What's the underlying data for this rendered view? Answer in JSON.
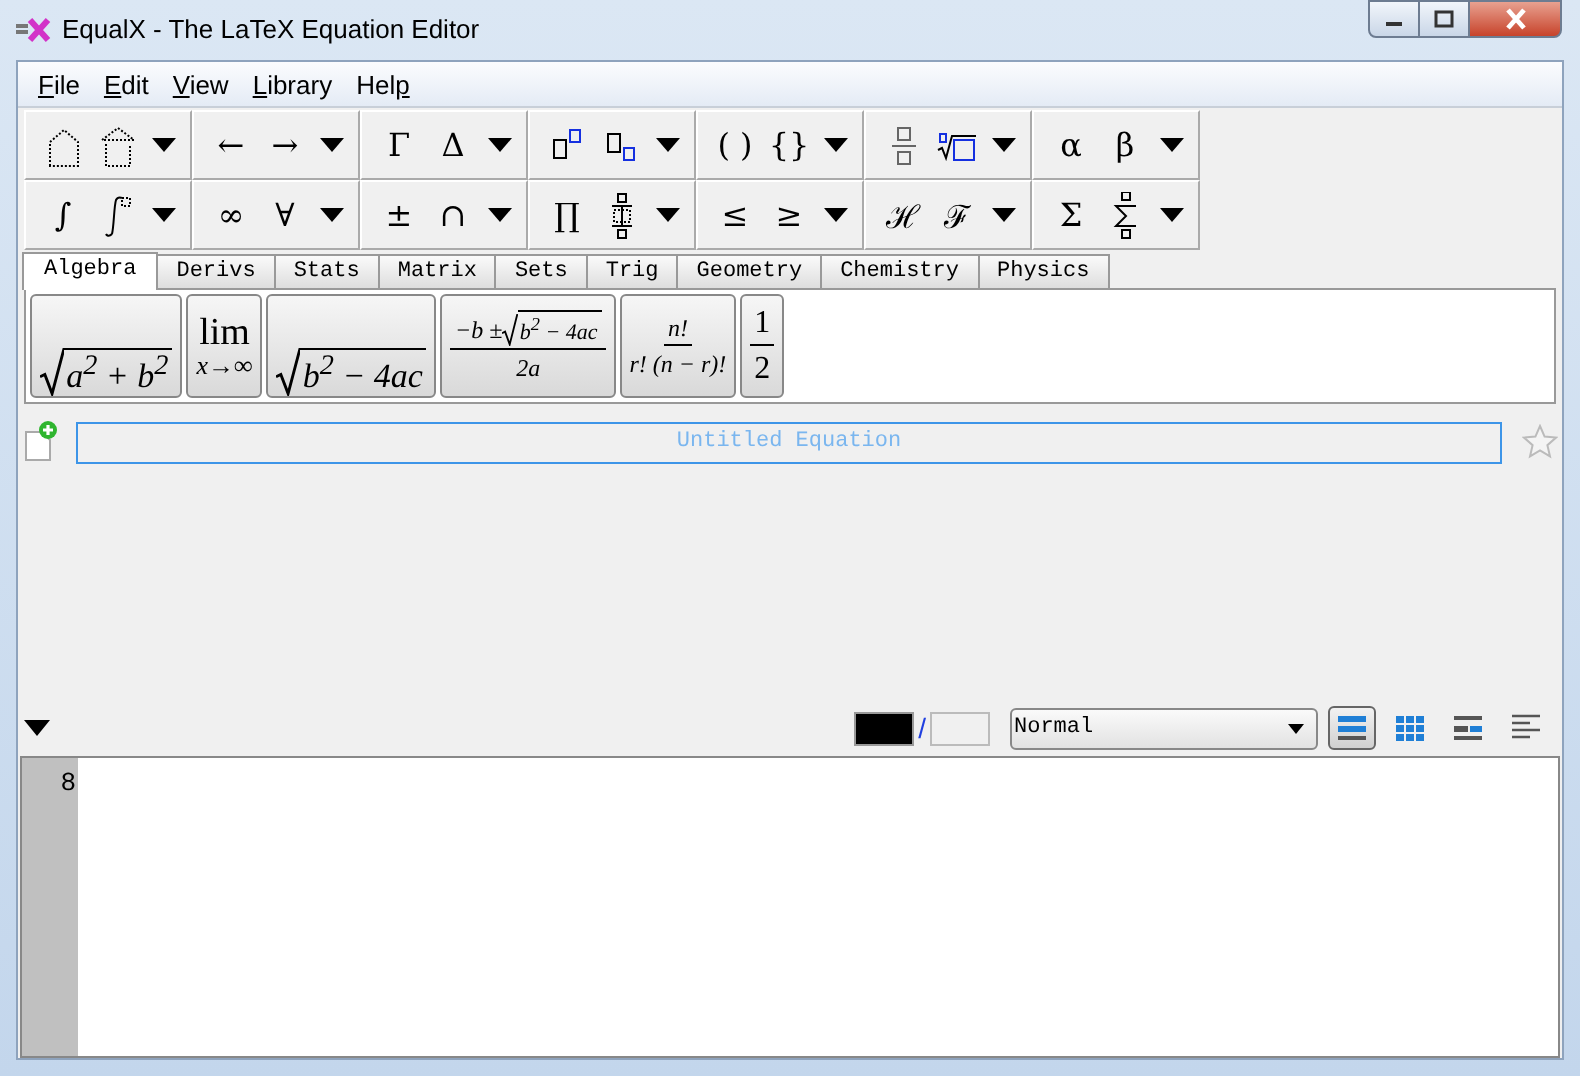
{
  "window": {
    "title": "EqualX - The LaTeX Equation Editor"
  },
  "menu": [
    {
      "key": "F",
      "after": "ile"
    },
    {
      "key": "E",
      "after": "dit"
    },
    {
      "key": "V",
      "after": "iew"
    },
    {
      "key": "L",
      "after": "ibrary"
    },
    {
      "before": "Hel",
      "key": "p"
    }
  ],
  "toolbar": {
    "rows": [
      [
        {
          "buttons": [
            {
              "kind": "hat"
            },
            {
              "kind": "hatbox"
            }
          ]
        },
        {
          "buttons": [
            {
              "kind": "symbol",
              "symbol": "←"
            },
            {
              "kind": "symbol",
              "symbol": "→"
            }
          ]
        },
        {
          "buttons": [
            {
              "kind": "symbol",
              "symbol": "Γ"
            },
            {
              "kind": "symbol",
              "symbol": "Δ"
            }
          ]
        },
        {
          "buttons": [
            {
              "kind": "supbox"
            },
            {
              "kind": "subbox"
            }
          ]
        },
        {
          "buttons": [
            {
              "kind": "symbol",
              "symbol": "( )"
            },
            {
              "kind": "symbol",
              "symbol": "{}"
            }
          ]
        },
        {
          "buttons": [
            {
              "kind": "fraction"
            },
            {
              "kind": "root"
            }
          ]
        },
        {
          "buttons": [
            {
              "kind": "symbol",
              "symbol": "α"
            },
            {
              "kind": "symbol",
              "symbol": "β"
            }
          ]
        }
      ],
      [
        {
          "buttons": [
            {
              "kind": "symbol",
              "symbol": "∫"
            },
            {
              "kind": "intlimits"
            }
          ]
        },
        {
          "buttons": [
            {
              "kind": "symbol",
              "symbol": "∞"
            },
            {
              "kind": "symbol",
              "symbol": "∀"
            }
          ]
        },
        {
          "buttons": [
            {
              "kind": "symbol",
              "symbol": "±"
            },
            {
              "kind": "symbol",
              "symbol": "∩"
            }
          ]
        },
        {
          "buttons": [
            {
              "kind": "symbol",
              "symbol": "∏"
            },
            {
              "kind": "stack"
            }
          ]
        },
        {
          "buttons": [
            {
              "kind": "symbol",
              "symbol": "≤"
            },
            {
              "kind": "symbol",
              "symbol": "≥"
            }
          ]
        },
        {
          "buttons": [
            {
              "kind": "symbol",
              "symbol": "ℋ"
            },
            {
              "kind": "symbol",
              "symbol": "ℱ"
            }
          ]
        },
        {
          "buttons": [
            {
              "kind": "symbol",
              "symbol": "Σ"
            },
            {
              "kind": "sumlimits"
            }
          ]
        }
      ]
    ]
  },
  "tabs": [
    {
      "label": "Algebra",
      "selected": true
    },
    {
      "label": "Derivs",
      "selected": false
    },
    {
      "label": "Stats",
      "selected": false
    },
    {
      "label": "Matrix",
      "selected": false
    },
    {
      "label": "Sets",
      "selected": false
    },
    {
      "label": "Trig",
      "selected": false
    },
    {
      "label": "Geometry",
      "selected": false
    },
    {
      "label": "Chemistry",
      "selected": false
    },
    {
      "label": "Physics",
      "selected": false
    }
  ],
  "formulas": [
    {
      "kind": "sqrt",
      "radicand": "a$^{2}$ + b$^{2}$"
    },
    {
      "kind": "limit",
      "top": "lim",
      "bottom": "x→∞"
    },
    {
      "kind": "sqrt",
      "radicand": "b$^{2}$ − 4ac"
    },
    {
      "kind": "fraction",
      "numerator": "−b ±",
      "numerator_radicand": "b$^{2}$ − 4ac",
      "denominator": "2a"
    },
    {
      "kind": "fraction",
      "numerator": "n!",
      "denominator": "r! (n − r)!"
    },
    {
      "kind": "fraction",
      "numerator": "1",
      "denominator": "2"
    }
  ],
  "name_field": {
    "placeholder": "Untitled Equation"
  },
  "bottom_bar": {
    "foreground": {
      "color": "#000000"
    },
    "separator": "/",
    "background": {
      "color": "#f0f0f0"
    },
    "size_select": {
      "value": "Normal"
    },
    "layout_buttons": [
      {
        "kind": "rows",
        "selected": true
      },
      {
        "kind": "grid",
        "selected": false
      },
      {
        "kind": "split",
        "selected": false
      },
      {
        "kind": "lines",
        "selected": false
      }
    ]
  },
  "editor": {
    "line_numbers": [
      "8"
    ]
  }
}
